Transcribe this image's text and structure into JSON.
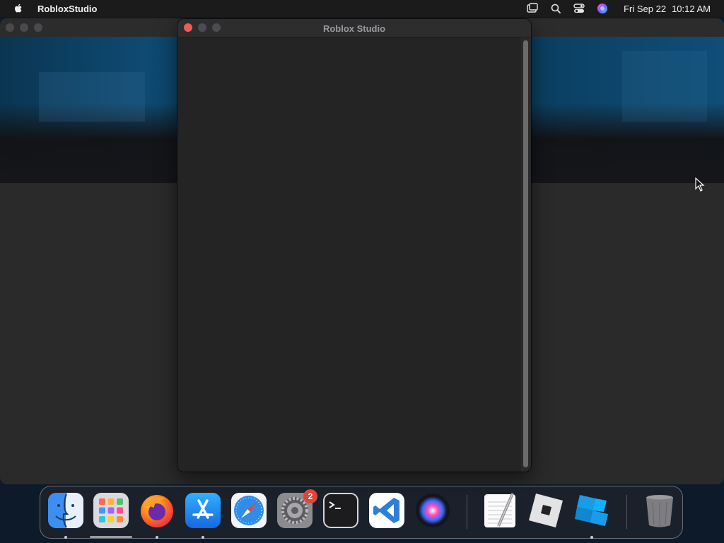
{
  "menubar": {
    "app_name": "RobloxStudio",
    "icons": [
      "apple-icon",
      "screen-mirroring-icon",
      "spotlight-search-icon",
      "control-center-icon",
      "siri-icon"
    ],
    "clock": {
      "date": "Fri Sep 22",
      "time": "10:12 AM"
    }
  },
  "main_window": {
    "title": "Roblox Studio"
  },
  "dock": {
    "apps": [
      {
        "name": "Finder",
        "icon": "finder-icon",
        "running": true
      },
      {
        "name": "Launchpad",
        "icon": "launchpad-icon",
        "running": false
      },
      {
        "name": "Firefox",
        "icon": "firefox-icon",
        "running": true
      },
      {
        "name": "App Store",
        "icon": "app-store-icon",
        "running": true
      },
      {
        "name": "Safari",
        "icon": "safari-icon",
        "running": false
      },
      {
        "name": "System Settings",
        "icon": "system-settings-icon",
        "running": false,
        "badge": "2"
      },
      {
        "name": "Terminal",
        "icon": "terminal-icon",
        "running": false
      },
      {
        "name": "Visual Studio Code",
        "icon": "vscode-icon",
        "running": false
      },
      {
        "name": "Siri",
        "icon": "siri-icon",
        "running": false
      },
      {
        "name": "TextEdit",
        "icon": "textedit-icon",
        "running": false
      },
      {
        "name": "Roblox Player",
        "icon": "roblox-icon",
        "running": false
      },
      {
        "name": "Roblox Studio",
        "icon": "roblox-studio-icon",
        "running": true
      },
      {
        "name": "Trash",
        "icon": "trash-icon",
        "running": false
      }
    ],
    "colors": {
      "finder": "#3d8ef0",
      "firefox": "#ff7b1c",
      "app_store": "#1a8cf2",
      "safari": "#2e8de8",
      "vscode": "#2f7fd6",
      "roblox_studio": "#1a9bea",
      "badge": "#e0443b"
    }
  }
}
